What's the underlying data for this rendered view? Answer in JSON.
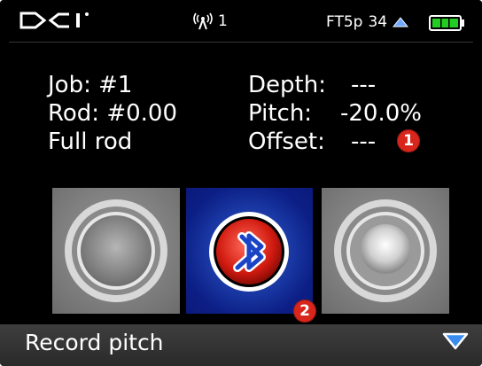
{
  "status_bar": {
    "logo_text": "DCI",
    "signal_icon": "antenna-signal-icon",
    "channel": "1",
    "frequency_label": "FT5p",
    "frequency_value": "34",
    "battery_icon": "battery-icon",
    "battery_color": "#22cc22"
  },
  "job_info": {
    "job": "Job: #1",
    "rod": "Rod: #0.00",
    "rod_status": "Full rod"
  },
  "readings": {
    "depth_label": "Depth:",
    "depth_value": "---",
    "pitch_label": "Pitch:",
    "pitch_value": "-20.0%",
    "offset_label": "Offset:",
    "offset_value": "---"
  },
  "callouts": {
    "one": "1",
    "two": "2"
  },
  "tiles": {
    "left_icon": "gray-circle-button-icon",
    "middle_icon": "bluetooth-pairing-icon",
    "right_icon": "gray-circle-button-icon"
  },
  "bottom_bar": {
    "label": "Record pitch",
    "arrow_icon": "down-triangle-icon"
  },
  "colors": {
    "accent_red": "#d9261c",
    "accent_blue": "#0b1a7a"
  }
}
